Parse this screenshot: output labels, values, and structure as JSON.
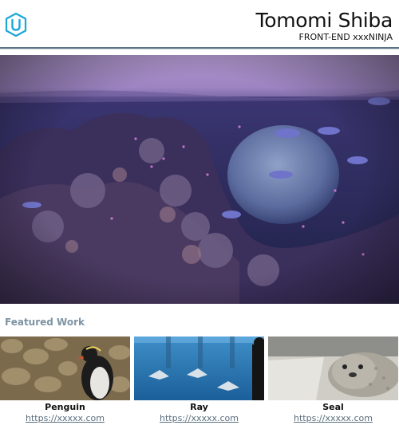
{
  "header": {
    "name": "Tomomi Shiba",
    "tagline": "FRONT-END xxxNINJA",
    "logo_icon": "udacity-u-icon",
    "logo_color": "#1aa7d8",
    "rule_color": "#5c7485"
  },
  "hero": {
    "image": "aquarium-hero-photo"
  },
  "featured": {
    "title": "Featured Work",
    "title_color": "#7d93a3",
    "items": [
      {
        "title": "Penguin",
        "link": "https://xxxxx.com",
        "image": "penguin-photo"
      },
      {
        "title": "Ray",
        "link": "https://xxxxx.com",
        "image": "ray-photo"
      },
      {
        "title": "Seal",
        "link": "https://xxxxx.com",
        "image": "seal-photo"
      }
    ]
  }
}
